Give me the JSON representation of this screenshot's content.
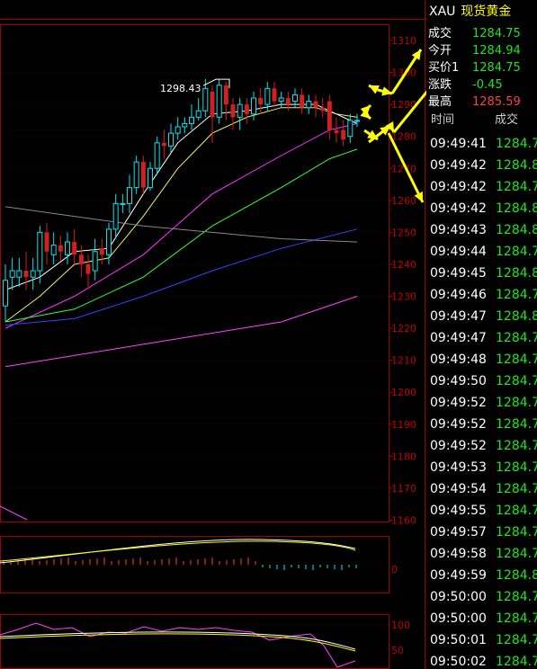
{
  "colors": {
    "background": "#000000",
    "frame": "#a00000",
    "grid": "#4a0000",
    "axis_label": "#c00000",
    "up_candle": "#00e8f0",
    "down_candle": "#d02020",
    "ma5": "#ffffff",
    "ma10": "#f0f070",
    "ma20": "#ff33ff",
    "ma60": "#33ff33",
    "ma120": "#3344ff",
    "ma250": "#888888",
    "trend_line": "#ff44ff",
    "arrow": "#ffff00",
    "up": "#1fe51f",
    "down": "#ff4040"
  },
  "quote": {
    "symbol": "XAU",
    "name": "现货黄金",
    "rows": [
      {
        "label": "成交",
        "value": "1284.75",
        "color": "#1fe51f"
      },
      {
        "label": "今开",
        "value": "1284.94",
        "color": "#1fe51f"
      },
      {
        "label": "买价1",
        "value": "1284.75",
        "color": "#1fe51f"
      },
      {
        "label": "涨跌",
        "value": "-0.45",
        "color": "#1fe51f"
      },
      {
        "label": "最高",
        "value": "1285.59",
        "color": "#ff4040"
      }
    ]
  },
  "ticks": {
    "header_time": "时间",
    "header_trade": "成交",
    "rows": [
      {
        "time": "09:49:41",
        "price": "1284.7"
      },
      {
        "time": "09:49:42",
        "price": "1284.8"
      },
      {
        "time": "09:49:42",
        "price": "1284.7"
      },
      {
        "time": "09:49:42",
        "price": "1284.8"
      },
      {
        "time": "09:49:43",
        "price": "1284.8"
      },
      {
        "time": "09:49:44",
        "price": "1284.7"
      },
      {
        "time": "09:49:45",
        "price": "1284.8"
      },
      {
        "time": "09:49:46",
        "price": "1284.7"
      },
      {
        "time": "09:49:47",
        "price": "1284.8"
      },
      {
        "time": "09:49:47",
        "price": "1284.7"
      },
      {
        "time": "09:49:48",
        "price": "1284.7"
      },
      {
        "time": "09:49:50",
        "price": "1284.7"
      },
      {
        "time": "09:49:52",
        "price": "1284.7"
      },
      {
        "time": "09:49:52",
        "price": "1284.7"
      },
      {
        "time": "09:49:52",
        "price": "1284.7"
      },
      {
        "time": "09:49:53",
        "price": "1284.7"
      },
      {
        "time": "09:49:54",
        "price": "1284.7"
      },
      {
        "time": "09:49:55",
        "price": "1284.7"
      },
      {
        "time": "09:49:57",
        "price": "1284.7"
      },
      {
        "time": "09:49:58",
        "price": "1284.7"
      },
      {
        "time": "09:49:59",
        "price": "1284.8"
      },
      {
        "time": "09:50:00",
        "price": "1284.7"
      },
      {
        "time": "09:50:00",
        "price": "1284.7"
      },
      {
        "time": "09:50:01",
        "price": "1284.7"
      },
      {
        "time": "09:50:02",
        "price": "1284.7"
      }
    ]
  },
  "chart_data": {
    "type": "candlestick",
    "price_axis": {
      "min": 1160,
      "max": 1310,
      "ticks": [
        1310,
        1300,
        1290,
        1280,
        1270,
        1260,
        1250,
        1240,
        1230,
        1220,
        1210,
        1200,
        1190,
        1180,
        1170,
        1160
      ]
    },
    "high_annotation": {
      "value": 1298.43,
      "label": "1298.43"
    },
    "candles": [
      {
        "o": 1227,
        "c": 1235,
        "h": 1240,
        "l": 1222
      },
      {
        "o": 1236,
        "c": 1238,
        "h": 1242,
        "l": 1232
      },
      {
        "o": 1236,
        "c": 1238,
        "h": 1242,
        "l": 1233
      },
      {
        "o": 1238,
        "c": 1236,
        "h": 1244,
        "l": 1232
      },
      {
        "o": 1236,
        "c": 1238,
        "h": 1242,
        "l": 1232
      },
      {
        "o": 1238,
        "c": 1250,
        "h": 1252,
        "l": 1234
      },
      {
        "o": 1250,
        "c": 1244,
        "h": 1253,
        "l": 1240
      },
      {
        "o": 1243,
        "c": 1246,
        "h": 1250,
        "l": 1240
      },
      {
        "o": 1246,
        "c": 1244,
        "h": 1249,
        "l": 1241
      },
      {
        "o": 1243,
        "c": 1247,
        "h": 1250,
        "l": 1240
      },
      {
        "o": 1247,
        "c": 1243,
        "h": 1251,
        "l": 1240
      },
      {
        "o": 1243,
        "c": 1240,
        "h": 1246,
        "l": 1236
      },
      {
        "o": 1240,
        "c": 1237,
        "h": 1243,
        "l": 1233
      },
      {
        "o": 1238,
        "c": 1244,
        "h": 1248,
        "l": 1235
      },
      {
        "o": 1245,
        "c": 1243,
        "h": 1248,
        "l": 1240
      },
      {
        "o": 1243,
        "c": 1251,
        "h": 1253,
        "l": 1240
      },
      {
        "o": 1251,
        "c": 1259,
        "h": 1262,
        "l": 1248
      },
      {
        "o": 1259,
        "c": 1259,
        "h": 1262,
        "l": 1256
      },
      {
        "o": 1259,
        "c": 1264,
        "h": 1268,
        "l": 1256
      },
      {
        "o": 1264,
        "c": 1272,
        "h": 1274,
        "l": 1262
      },
      {
        "o": 1272,
        "c": 1264,
        "h": 1274,
        "l": 1262
      },
      {
        "o": 1264,
        "c": 1270,
        "h": 1272,
        "l": 1263
      },
      {
        "o": 1270,
        "c": 1278,
        "h": 1280,
        "l": 1268
      },
      {
        "o": 1278,
        "c": 1277,
        "h": 1282,
        "l": 1273
      },
      {
        "o": 1277,
        "c": 1281,
        "h": 1284,
        "l": 1275
      },
      {
        "o": 1281,
        "c": 1283,
        "h": 1286,
        "l": 1279
      },
      {
        "o": 1283,
        "c": 1284,
        "h": 1286,
        "l": 1281
      },
      {
        "o": 1284,
        "c": 1286,
        "h": 1290,
        "l": 1282
      },
      {
        "o": 1286,
        "c": 1288,
        "h": 1292,
        "l": 1285
      },
      {
        "o": 1288,
        "c": 1295,
        "h": 1298,
        "l": 1286
      },
      {
        "o": 1294,
        "c": 1286,
        "h": 1296,
        "l": 1278
      },
      {
        "o": 1286,
        "c": 1296,
        "h": 1298,
        "l": 1284
      },
      {
        "o": 1296,
        "c": 1290,
        "h": 1297,
        "l": 1285
      },
      {
        "o": 1290,
        "c": 1286,
        "h": 1292,
        "l": 1282
      },
      {
        "o": 1286,
        "c": 1290,
        "h": 1292,
        "l": 1282
      },
      {
        "o": 1290,
        "c": 1287,
        "h": 1292,
        "l": 1284
      },
      {
        "o": 1287,
        "c": 1292,
        "h": 1294,
        "l": 1285
      },
      {
        "o": 1292,
        "c": 1290,
        "h": 1295,
        "l": 1287
      },
      {
        "o": 1290,
        "c": 1295,
        "h": 1297,
        "l": 1288
      },
      {
        "o": 1295,
        "c": 1291,
        "h": 1297,
        "l": 1289
      },
      {
        "o": 1291,
        "c": 1292,
        "h": 1294,
        "l": 1289
      },
      {
        "o": 1292,
        "c": 1290,
        "h": 1294,
        "l": 1288
      },
      {
        "o": 1291,
        "c": 1293,
        "h": 1295,
        "l": 1289
      },
      {
        "o": 1293,
        "c": 1289,
        "h": 1295,
        "l": 1287
      },
      {
        "o": 1289,
        "c": 1291,
        "h": 1293,
        "l": 1287
      },
      {
        "o": 1291,
        "c": 1289,
        "h": 1293,
        "l": 1286
      },
      {
        "o": 1289,
        "c": 1288,
        "h": 1292,
        "l": 1286
      },
      {
        "o": 1291,
        "c": 1282,
        "h": 1293,
        "l": 1279
      },
      {
        "o": 1282,
        "c": 1281,
        "h": 1286,
        "l": 1278
      },
      {
        "o": 1282,
        "c": 1279,
        "h": 1285,
        "l": 1277
      },
      {
        "o": 1280,
        "c": 1285,
        "h": 1287,
        "l": 1278
      },
      {
        "o": 1285,
        "c": 1285,
        "h": 1287,
        "l": 1283
      }
    ],
    "ma_lines": [
      {
        "color": "#ffffff",
        "pts": [
          [
            0,
            1232
          ],
          [
            5,
            1236
          ],
          [
            10,
            1244
          ],
          [
            15,
            1245
          ],
          [
            20,
            1262
          ],
          [
            25,
            1278
          ],
          [
            30,
            1287
          ],
          [
            35,
            1288
          ],
          [
            40,
            1290
          ],
          [
            45,
            1290
          ],
          [
            48,
            1287
          ],
          [
            51,
            1284
          ]
        ]
      },
      {
        "color": "#f0f070",
        "pts": [
          [
            0,
            1222
          ],
          [
            5,
            1230
          ],
          [
            10,
            1240
          ],
          [
            15,
            1242
          ],
          [
            20,
            1255
          ],
          [
            25,
            1270
          ],
          [
            30,
            1281
          ],
          [
            35,
            1286
          ],
          [
            40,
            1289
          ],
          [
            45,
            1289
          ],
          [
            48,
            1287
          ],
          [
            51,
            1286
          ]
        ]
      },
      {
        "color": "#ff33ff",
        "pts": [
          [
            0,
            1220
          ],
          [
            10,
            1230
          ],
          [
            20,
            1243
          ],
          [
            30,
            1262
          ],
          [
            40,
            1274
          ],
          [
            47,
            1282
          ],
          [
            51,
            1284
          ]
        ]
      },
      {
        "color": "#33ff33",
        "pts": [
          [
            0,
            1222
          ],
          [
            10,
            1226
          ],
          [
            20,
            1236
          ],
          [
            30,
            1252
          ],
          [
            40,
            1264
          ],
          [
            47,
            1273
          ],
          [
            51,
            1276
          ]
        ]
      },
      {
        "color": "#3344ff",
        "pts": [
          [
            0,
            1221
          ],
          [
            10,
            1223
          ],
          [
            20,
            1230
          ],
          [
            30,
            1238
          ],
          [
            40,
            1245
          ],
          [
            51,
            1251
          ]
        ]
      },
      {
        "color": "#888888",
        "pts": [
          [
            0,
            1258
          ],
          [
            10,
            1255
          ],
          [
            20,
            1252
          ],
          [
            30,
            1250
          ],
          [
            40,
            1248
          ],
          [
            51,
            1247
          ]
        ]
      },
      {
        "color": "#ff44ff",
        "pts": [
          [
            0,
            1208
          ],
          [
            20,
            1215
          ],
          [
            40,
            1222
          ],
          [
            51,
            1230
          ]
        ]
      }
    ],
    "macd": {
      "zero_label": "0"
    },
    "kdj": {
      "labels": [
        "100",
        "50"
      ]
    }
  }
}
